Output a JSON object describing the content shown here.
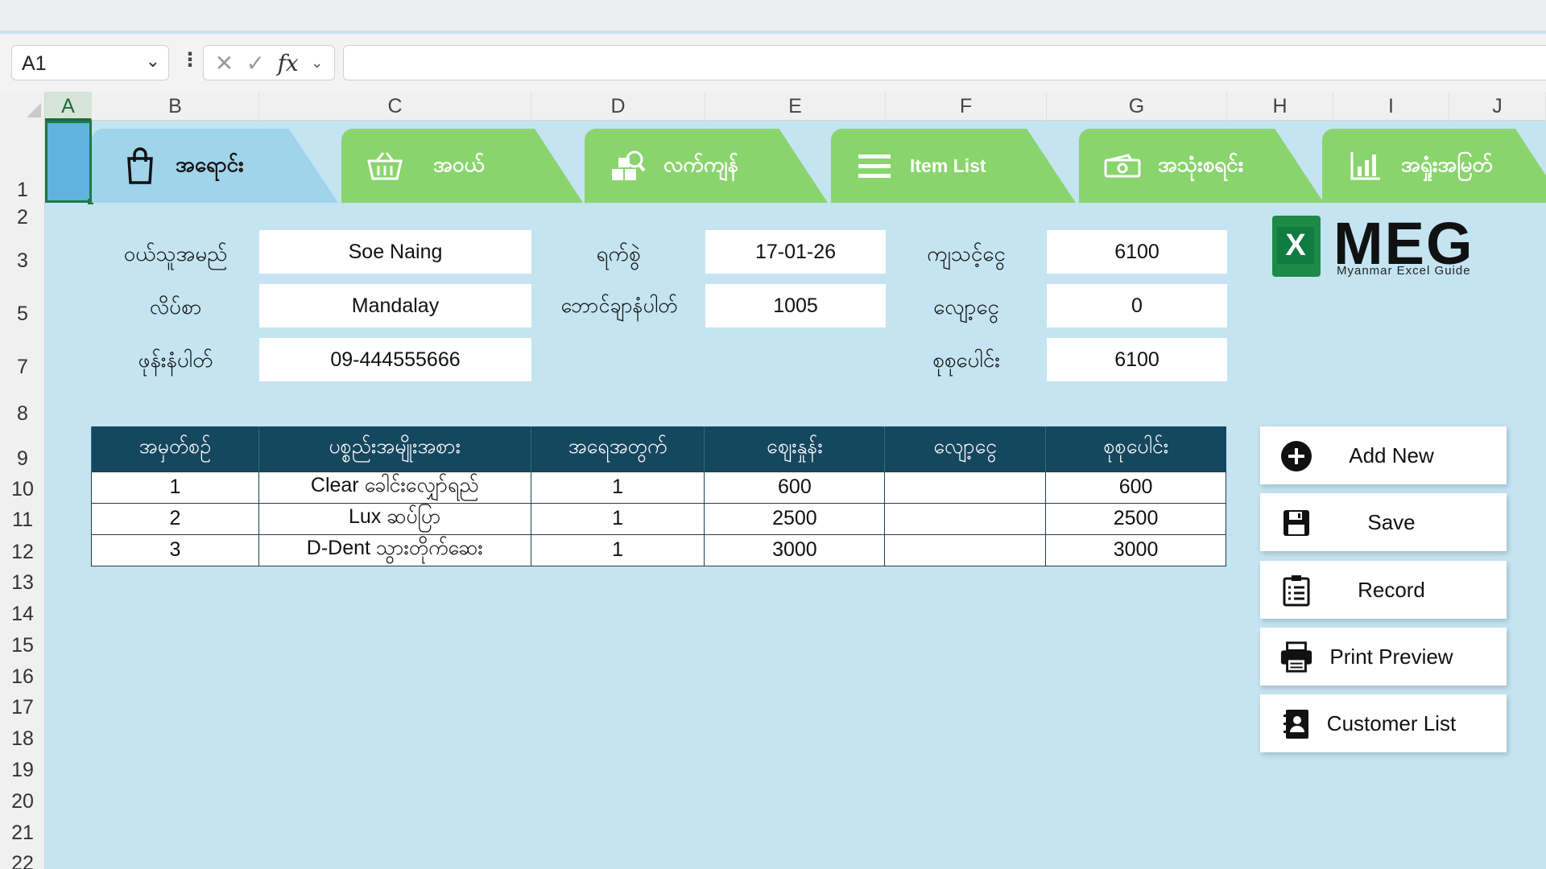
{
  "formula_bar": {
    "name_box": "A1",
    "formula": ""
  },
  "columns": [
    "A",
    "B",
    "C",
    "D",
    "E",
    "F",
    "G",
    "H",
    "I",
    "J"
  ],
  "rows": [
    "1",
    "2",
    "3",
    "5",
    "7",
    "8",
    "9",
    "10",
    "11",
    "12",
    "13",
    "14",
    "15",
    "16",
    "17",
    "18",
    "19",
    "20",
    "21",
    "22"
  ],
  "tabs": [
    {
      "label": "အရောင်း",
      "icon": "shopping-bag-icon"
    },
    {
      "label": "အဝယ်",
      "icon": "basket-icon"
    },
    {
      "label": "လက်ကျန်",
      "icon": "stock-search-icon"
    },
    {
      "label": "Item List",
      "icon": "list-icon"
    },
    {
      "label": "အသုံးစရင်း",
      "icon": "money-icon"
    },
    {
      "label": "အရှုံးအမြတ်",
      "icon": "bar-chart-icon"
    }
  ],
  "form": {
    "customer_name_label": "ဝယ်သူအမည်",
    "customer_name": "Soe Naing",
    "address_label": "လိပ်စာ",
    "address": "Mandalay",
    "phone_label": "ဖုန်းနံပါတ်",
    "phone": "09-444555666",
    "date_label": "ရက်စွဲ",
    "date": "17-01-26",
    "voucher_label": "ဘောင်ချာနံပါတ်",
    "voucher": "1005",
    "subtotal_label": "ကျသင့်ငွေ",
    "subtotal": "6100",
    "discount_label": "လျော့ငွေ",
    "discount": "0",
    "total_label": "စုစုပေါင်း",
    "total": "6100"
  },
  "logo": {
    "letter": "X",
    "title": "MEG",
    "subtitle": "Myanmar Excel Guide"
  },
  "table": {
    "headers": [
      "အမှတ်စဉ်",
      "ပစ္စည်းအမျိုးအစား",
      "အရေအတွက်",
      "ဈေးနှုန်း",
      "လျော့ငွေ",
      "စုစုပေါင်း"
    ],
    "rows": [
      [
        "1",
        "Clear ခေါင်းလျှော်ရည်",
        "1",
        "600",
        "",
        "600"
      ],
      [
        "2",
        "Lux ဆပ်ပြာ",
        "1",
        "2500",
        "",
        "2500"
      ],
      [
        "3",
        "D-Dent သွားတိုက်ဆေး",
        "1",
        "3000",
        "",
        "3000"
      ]
    ]
  },
  "buttons": {
    "add_new": "Add New",
    "save": "Save",
    "record": "Record",
    "print_preview": "Print Preview",
    "customer_list": "Customer List"
  },
  "colors": {
    "sheet_bg": "#c4e4f2",
    "tab_green": "#8ad46e",
    "tab_active": "#9fd4ea",
    "table_header": "#15475f",
    "excel_green": "#1e7a45"
  }
}
